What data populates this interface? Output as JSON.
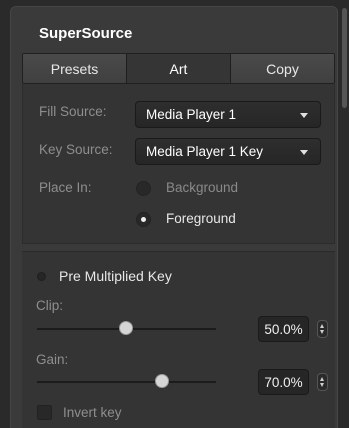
{
  "panel": {
    "title": "SuperSource"
  },
  "tabs": [
    {
      "label": "Presets",
      "active": false
    },
    {
      "label": "Art",
      "active": true
    },
    {
      "label": "Copy",
      "active": false
    }
  ],
  "art": {
    "fill_source": {
      "label": "Fill Source:",
      "value": "Media Player 1"
    },
    "key_source": {
      "label": "Key Source:",
      "value": "Media Player 1 Key"
    },
    "place_in": {
      "label": "Place In:",
      "options": [
        {
          "label": "Background",
          "selected": false
        },
        {
          "label": "Foreground",
          "selected": true
        }
      ]
    }
  },
  "key": {
    "pre_multiplied": {
      "label": "Pre Multiplied Key",
      "enabled": false
    },
    "clip": {
      "label": "Clip:",
      "value": "50.0%",
      "fraction": 0.5
    },
    "gain": {
      "label": "Gain:",
      "value": "70.0%",
      "fraction": 0.7
    },
    "invert": {
      "label": "Invert key",
      "checked": false
    }
  },
  "icons": {
    "dropdown_caret": "chevron-down-icon",
    "stepper": "up-down-stepper-icon"
  },
  "colors": {
    "panel_bg": "#3a3a3a",
    "section_bg": "#343434",
    "page_bg": "#2a2a2a",
    "text_primary": "#ffffff",
    "text_muted": "#8e8e8e"
  }
}
